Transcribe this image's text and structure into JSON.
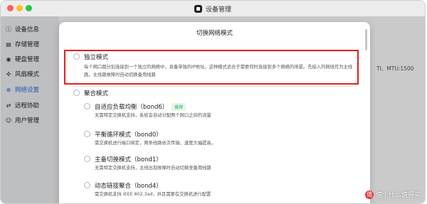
{
  "window": {
    "title": "设备管理",
    "traffic_colors": [
      "#ff5f57",
      "#febc2e",
      "#28c840"
    ]
  },
  "sidebar": {
    "items": [
      {
        "label": "设备信息",
        "icon": "info-icon",
        "active": false
      },
      {
        "label": "存储管理",
        "icon": "storage-icon",
        "active": false
      },
      {
        "label": "硬盘管理",
        "icon": "disk-icon",
        "active": false
      },
      {
        "label": "风扇模式",
        "icon": "fan-icon",
        "active": false
      },
      {
        "label": "网络设置",
        "icon": "network-icon",
        "active": true
      },
      {
        "label": "远程协助",
        "icon": "remote-icon",
        "active": false
      },
      {
        "label": "用户管理",
        "icon": "user-icon",
        "active": false
      }
    ]
  },
  "background": {
    "partial_text": "TI、MTU:1500"
  },
  "modal": {
    "title": "切换网络模式",
    "options": [
      {
        "title": "独立模式",
        "desc": "每个网口都分别连接到一个独立的网络中，具备单独的IP地址。这种模式适合于需要同时连接到多个网络的场景。先接入的网线作为主线路，主线路故障时自动切换备用线路"
      },
      {
        "title": "聚合模式",
        "desc": ""
      }
    ],
    "sub_options": [
      {
        "title": "自适应负载均衡（bond6）",
        "badge": "推荐",
        "desc": "无需特定交换机支持，系统会自动分配两个网口之间的流量"
      },
      {
        "title": "平衡循环模式（bond0）",
        "badge": "",
        "desc": "需交换机进行端口绑定，两条线路依次传输，速度大幅提高。"
      },
      {
        "title": "主备切换模式（bond1）",
        "badge": "",
        "desc": "无需特定交换机支持，主线出现故障时自动切换至备用线路"
      },
      {
        "title": "动态链接聚合（bond4）",
        "badge": "",
        "desc": "需交换机支持 IEEE 802.3ad，并且需要在交换机进行配置"
      }
    ]
  },
  "watermark": {
    "text": "值 | 什么值得买",
    "logo": "值"
  },
  "colors": {
    "accent": "#2b6fd8",
    "highlight": "#e0211b",
    "badge_green": "#34a853"
  }
}
